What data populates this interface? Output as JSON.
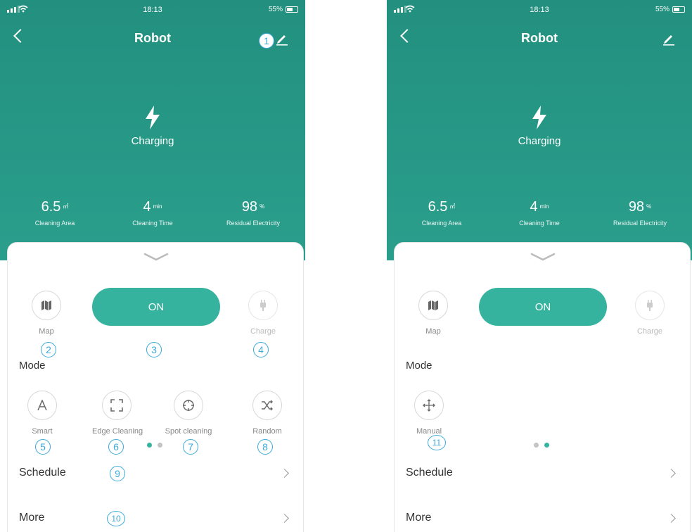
{
  "status_bar": {
    "time": "18:13",
    "battery": "55%"
  },
  "header": {
    "title": "Robot"
  },
  "hero": {
    "status": "Charging"
  },
  "stats": [
    {
      "value": "6.5",
      "unit": "㎡",
      "label": "Cleaning Area"
    },
    {
      "value": "4",
      "unit": "min",
      "label": "Cleaning Time"
    },
    {
      "value": "98",
      "unit": "%",
      "label": "Residual Electricity"
    }
  ],
  "controls": {
    "map_label": "Map",
    "power_label": "ON",
    "charge_label": "Charge"
  },
  "mode": {
    "title": "Mode",
    "page1": [
      {
        "label": "Smart",
        "icon": "letter-a-icon"
      },
      {
        "label": "Edge Cleaning",
        "icon": "edge-frame-icon"
      },
      {
        "label": "Spot cleaning",
        "icon": "target-icon"
      },
      {
        "label": "Random",
        "icon": "shuffle-icon"
      }
    ],
    "page2": [
      {
        "label": "Manual",
        "icon": "move-arrows-icon"
      }
    ]
  },
  "menu": {
    "schedule": "Schedule",
    "more": "More"
  },
  "markers": {
    "left": [
      "1",
      "2",
      "3",
      "4",
      "5",
      "6",
      "7",
      "8",
      "9",
      "10"
    ],
    "right": [
      "11"
    ]
  },
  "colors": {
    "header_teal": "#23907f",
    "accent": "#36b39e",
    "marker_blue": "#3ba9d9",
    "dot_active": "#36b39e",
    "dot_inactive": "#c4c4c4"
  }
}
